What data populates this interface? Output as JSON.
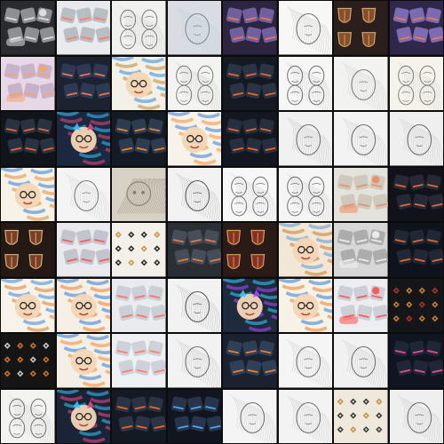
{
  "gallery": {
    "rows": 8,
    "cols": 8,
    "tiles": [
      {
        "name": "ui-devices-flatlay-dark",
        "subject": "ui-devices",
        "bg": "#2a2b2f",
        "fg": "#cfd2d8",
        "accent": "#e7e7e7"
      },
      {
        "name": "mobile-ui-cards-light",
        "subject": "mobile-ui",
        "bg": "#e8eaee",
        "fg": "#9aa0aa",
        "accent": "#ff7a59"
      },
      {
        "name": "pencil-sketch-faces",
        "subject": "sketch-faces",
        "bg": "#f0f0ef",
        "fg": "#444",
        "accent": "#999"
      },
      {
        "name": "laptop-desk-photo",
        "subject": "laptop-desk",
        "bg": "#d9dde3",
        "fg": "#555e6b",
        "accent": "#8eb6d8"
      },
      {
        "name": "purple-dashboard-ui",
        "subject": "dashboard-dark",
        "bg": "#2d2440",
        "fg": "#7d6bb0",
        "accent": "#ff7a3d"
      },
      {
        "name": "woman-portrait-sketch",
        "subject": "sketch-portrait",
        "bg": "#f7f7f6",
        "fg": "#333",
        "accent": "#777"
      },
      {
        "name": "shields-dark",
        "subject": "shields",
        "bg": "#2a1f1c",
        "fg": "#8a4d2a",
        "accent": "#c9a86a"
      },
      {
        "name": "purple-dashboard-ui-2",
        "subject": "dashboard-dark",
        "bg": "#30284a",
        "fg": "#8977c4",
        "accent": "#ff7a3d"
      },
      {
        "name": "retro-device-ui-pastel",
        "subject": "ui-devices",
        "bg": "#e6d8e7",
        "fg": "#b39ab8",
        "accent": "#f2a46b"
      },
      {
        "name": "dark-mobile-ui-cards",
        "subject": "mobile-ui",
        "bg": "#1c2230",
        "fg": "#3b4a6b",
        "accent": "#ff7a59"
      },
      {
        "name": "colorful-boy-glasses-sketch",
        "subject": "colorful-face",
        "bg": "#f3f0e8",
        "fg": "#b9882b",
        "accent": "#2d8bdc"
      },
      {
        "name": "ink-man-face-sketch",
        "subject": "sketch-faces",
        "bg": "#f3f3f2",
        "fg": "#444",
        "accent": "#888"
      },
      {
        "name": "dark-ui-grid-dashboard",
        "subject": "dashboard-dark",
        "bg": "#151a22",
        "fg": "#2f3a4a",
        "accent": "#ff6a2b"
      },
      {
        "name": "multiple-faces-sketch",
        "subject": "sketch-faces",
        "bg": "#f6f6f6",
        "fg": "#333",
        "accent": "#888"
      },
      {
        "name": "sketch-man-reading",
        "subject": "sketch-portrait",
        "bg": "#f2f2f0",
        "fg": "#444",
        "accent": "#999"
      },
      {
        "name": "faces-sketch-sheet",
        "subject": "sketch-faces",
        "bg": "#f5f3ec",
        "fg": "#4a4a4a",
        "accent": "#999"
      },
      {
        "name": "dark-ui-cards-3d",
        "subject": "dashboard-dark",
        "bg": "#10141b",
        "fg": "#2d3747",
        "accent": "#ff6a2b"
      },
      {
        "name": "colorful-cat-illustration",
        "subject": "colorful-cat",
        "bg": "#1b2840",
        "fg": "#e84a7a",
        "accent": "#37c7ff"
      },
      {
        "name": "dark-mixer-ui",
        "subject": "dashboard-dark",
        "bg": "#151b25",
        "fg": "#334258",
        "accent": "#ff8a2b"
      },
      {
        "name": "child-glasses-crayon",
        "subject": "colorful-face",
        "bg": "#f7f3ea",
        "fg": "#ff8b2b",
        "accent": "#3c79d1"
      },
      {
        "name": "dark-ui-orange-accent",
        "subject": "dashboard-dark",
        "bg": "#131820",
        "fg": "#2a3444",
        "accent": "#ff6a2b"
      },
      {
        "name": "woman-sketch-pencil",
        "subject": "sketch-portrait",
        "bg": "#f1f1f1",
        "fg": "#333",
        "accent": "#777"
      },
      {
        "name": "woman-portrait-drawing",
        "subject": "sketch-portrait",
        "bg": "#f3f3f3",
        "fg": "#2e2e2e",
        "accent": "#8a8a8a"
      },
      {
        "name": "woman-profile-sketch",
        "subject": "sketch-portrait",
        "bg": "#efefef",
        "fg": "#2e2e2e",
        "accent": "#8a8a8a"
      },
      {
        "name": "crayon-man-glasses",
        "subject": "colorful-face",
        "bg": "#f6f2e8",
        "fg": "#e18a2b",
        "accent": "#2e7dd6"
      },
      {
        "name": "figure-sketch-study",
        "subject": "sketch-portrait",
        "bg": "#f4f4f4",
        "fg": "#444",
        "accent": "#999"
      },
      {
        "name": "fluffy-cat-sketch",
        "subject": "sketch-cat",
        "bg": "#d8d2c6",
        "fg": "#6a5a48",
        "accent": "#a89576"
      },
      {
        "name": "woman-ink-drawing",
        "subject": "sketch-portrait",
        "bg": "#f2f2f2",
        "fg": "#111",
        "accent": "#666"
      },
      {
        "name": "heads-sketch-grid",
        "subject": "sketch-faces",
        "bg": "#f7f7f7",
        "fg": "#333",
        "accent": "#888"
      },
      {
        "name": "busts-sketch-grid",
        "subject": "sketch-faces",
        "bg": "#f5f5f5",
        "fg": "#333",
        "accent": "#888"
      },
      {
        "name": "pastel-ui-device-kit",
        "subject": "ui-devices",
        "bg": "#e4e2dc",
        "fg": "#c0b8a8",
        "accent": "#f08a5d"
      },
      {
        "name": "dark-ui-cards-purple",
        "subject": "dashboard-dark",
        "bg": "#12131a",
        "fg": "#2a2d3c",
        "accent": "#ff6a2b"
      },
      {
        "name": "shields-wood",
        "subject": "shields",
        "bg": "#241915",
        "fg": "#7a3e24",
        "accent": "#d2b07a"
      },
      {
        "name": "mobile-ui-red-cards",
        "subject": "mobile-ui",
        "bg": "#e9e9ee",
        "fg": "#a9aeb8",
        "accent": "#ff4f4f"
      },
      {
        "name": "ornamental-icons-pattern",
        "subject": "ornaments",
        "bg": "#f3f0ea",
        "fg": "#1a1a1a",
        "accent": "#c88d3b"
      },
      {
        "name": "grey-ui-cards-3d",
        "subject": "dashboard-dark",
        "bg": "#2a2e35",
        "fg": "#4a525e",
        "accent": "#ff7a3d"
      },
      {
        "name": "shields-red-gold",
        "subject": "shields",
        "bg": "#2a1b18",
        "fg": "#8a2f24",
        "accent": "#caa35b"
      },
      {
        "name": "boy-glasses-painted",
        "subject": "colorful-face",
        "bg": "#f2e7d6",
        "fg": "#c67c2a",
        "accent": "#5a9bd6"
      },
      {
        "name": "grey-gadgets-flatlay",
        "subject": "ui-devices",
        "bg": "#d7d7d7",
        "fg": "#8f8f8f",
        "accent": "#f2f2f2"
      },
      {
        "name": "dark-mobile-phones-3d",
        "subject": "mobile-ui",
        "bg": "#0f141c",
        "fg": "#2a3545",
        "accent": "#ff6a2b"
      },
      {
        "name": "crayon-man-glasses-2",
        "subject": "colorful-face",
        "bg": "#f7f3ea",
        "fg": "#d97b2a",
        "accent": "#3a86d9"
      },
      {
        "name": "cartoon-boy-glasses",
        "subject": "colorful-face",
        "bg": "#f6efe5",
        "fg": "#f07b2a",
        "accent": "#2c7bd8"
      },
      {
        "name": "white-ui-tiles-3d",
        "subject": "mobile-ui",
        "bg": "#e9ebef",
        "fg": "#b7bcc5",
        "accent": "#ff6a5a"
      },
      {
        "name": "woman-charcoal",
        "subject": "sketch-portrait",
        "bg": "#f2f2f2",
        "fg": "#111",
        "accent": "#666"
      },
      {
        "name": "cat-purple-illustration",
        "subject": "colorful-cat",
        "bg": "#1d2b3c",
        "fg": "#b14bff",
        "accent": "#3bd0ff"
      },
      {
        "name": "boy-glasses-laptop",
        "subject": "colorful-face",
        "bg": "#f7f2e6",
        "fg": "#f07b2a",
        "accent": "#2f7cd6"
      },
      {
        "name": "white-ui-devices-3d",
        "subject": "ui-devices",
        "bg": "#ecedf0",
        "fg": "#b8bcc4",
        "accent": "#ff4f4f"
      },
      {
        "name": "dark-ornament-icons",
        "subject": "ornaments",
        "bg": "#15161a",
        "fg": "#d98b2b",
        "accent": "#b53a2a"
      },
      {
        "name": "minimal-icons-dark",
        "subject": "ornaments",
        "bg": "#151516",
        "fg": "#e07a2b",
        "accent": "#d9d9d9"
      },
      {
        "name": "cartoon-boy-big-glasses",
        "subject": "colorful-face",
        "bg": "#f3efe6",
        "fg": "#f08a2b",
        "accent": "#2f7cd6"
      },
      {
        "name": "white-ui-cards",
        "subject": "mobile-ui",
        "bg": "#eef0f4",
        "fg": "#b7bdc8",
        "accent": "#ff7a59"
      },
      {
        "name": "engineer-sketch",
        "subject": "sketch-portrait",
        "bg": "#f2f2f2",
        "fg": "#333",
        "accent": "#777"
      },
      {
        "name": "mixer-desk-ui",
        "subject": "dashboard-dark",
        "bg": "#1a2230",
        "fg": "#32445e",
        "accent": "#ff8a2b"
      },
      {
        "name": "woman-pencil-portrait",
        "subject": "sketch-portrait",
        "bg": "#f5f5f5",
        "fg": "#333",
        "accent": "#888"
      },
      {
        "name": "woman-realistic-sketch",
        "subject": "sketch-portrait",
        "bg": "#f1f1f1",
        "fg": "#333",
        "accent": "#888"
      },
      {
        "name": "dark-mobile-ui-gradient",
        "subject": "mobile-ui",
        "bg": "#111521",
        "fg": "#2a3346",
        "accent": "#ff4fa3"
      },
      {
        "name": "faces-sketch-rows",
        "subject": "sketch-faces",
        "bg": "#f3f3f2",
        "fg": "#333",
        "accent": "#888"
      },
      {
        "name": "colorful-cat-portrait",
        "subject": "colorful-cat",
        "bg": "#1a2436",
        "fg": "#f24a8a",
        "accent": "#35c8ff"
      },
      {
        "name": "dark-ui-sliders",
        "subject": "dashboard-dark",
        "bg": "#141a24",
        "fg": "#2e394b",
        "accent": "#ff6a2b"
      },
      {
        "name": "dark-ui-screens-blue",
        "subject": "dashboard-dark",
        "bg": "#10151f",
        "fg": "#2b3a52",
        "accent": "#4fb3ff"
      },
      {
        "name": "woman-pencil-2",
        "subject": "sketch-portrait",
        "bg": "#f4f4f4",
        "fg": "#333",
        "accent": "#888"
      },
      {
        "name": "couple-sketch",
        "subject": "sketch-portrait",
        "bg": "#f3f3f3",
        "fg": "#333",
        "accent": "#888"
      },
      {
        "name": "ornamental-symbols-grid",
        "subject": "ornaments",
        "bg": "#efe8dc",
        "fg": "#2a2a2a",
        "accent": "#c28a3b"
      },
      {
        "name": "figure-sketch-sitting",
        "subject": "sketch-portrait",
        "bg": "#efefef",
        "fg": "#333",
        "accent": "#888"
      }
    ]
  }
}
